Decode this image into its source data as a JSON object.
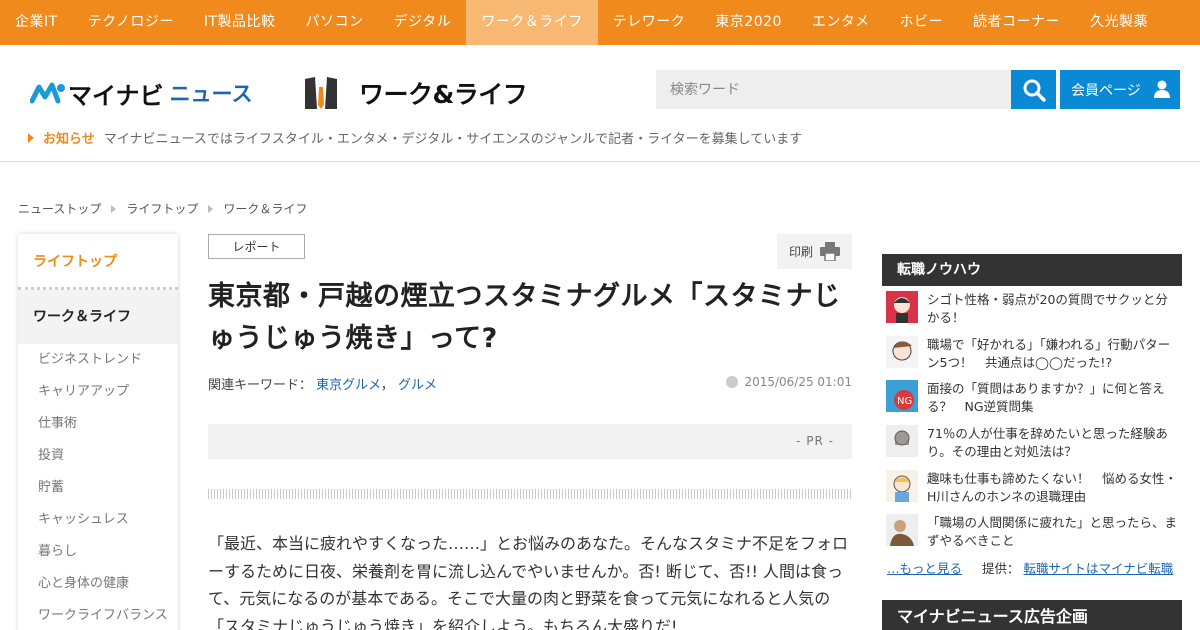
{
  "nav": {
    "items": [
      "企業IT",
      "テクノロジー",
      "IT製品比較",
      "パソコン",
      "デジタル",
      "ワーク＆ライフ",
      "テレワーク",
      "東京2020",
      "エンタメ",
      "ホビー",
      "読者コーナー",
      "久光製薬"
    ],
    "active_index": 5
  },
  "header": {
    "logo_text": "マイナビ",
    "logo_news": "ニュース",
    "section_title": "ワーク&ライフ",
    "search_placeholder": "検索ワード",
    "member_label": "会員ページ",
    "notice_label": "お知らせ",
    "notice_text": "マイナビニュースではライフスタイル・エンタメ・デジタル・サイエンスのジャンルで記者・ライターを募集しています"
  },
  "breadcrumb": [
    "ニューストップ",
    "ライフトップ",
    "ワーク＆ライフ"
  ],
  "leftnav": {
    "top": "ライフトップ",
    "current": "ワーク＆ライフ",
    "items": [
      "ビジネストレンド",
      "キャリアアップ",
      "仕事術",
      "投資",
      "貯蓄",
      "キャッシュレス",
      "暮らし",
      "心と身体の健康",
      "ワークライフバランス"
    ]
  },
  "article": {
    "tag": "レポート",
    "print_label": "印刷",
    "title": "東京都・戸越の煙立つスタミナグルメ「スタミナじゅうじゅう焼き」って?",
    "keywords_label": "関連キーワード：",
    "keywords": [
      "東京グルメ",
      "グルメ"
    ],
    "date": "2015/06/25 01:01",
    "pr_label": "- PR -",
    "body": "「最近、本当に疲れやすくなった……」とお悩みのあなた。そんなスタミナ不足をフォローするために日夜、栄養剤を胃に流し込んでやいませんか。否! 断じて、否!! 人間は食って、元気になるのが基本である。そこで大量の肉と野菜を食って元気になれると人気の「スタミナじゅうじゅう焼き」を紹介しよう。もちろん大盛りだ!"
  },
  "sidebar": {
    "job_title": "転職ノウハウ",
    "jobs": [
      "シゴト性格・弱点が20の質問でサクッと分かる！",
      "職場で「好かれる」「嫌われる」行動パターン5つ！　共通点は◯◯だった!?",
      "面接の「質問はありますか？」に何と答える？　NG逆質問集",
      "71％の人が仕事を辞めたいと思った経験あり。その理由と対処法は？",
      "趣味も仕事も諦めたくない！　悩める女性・H川さんのホンネの退職理由",
      "「職場の人間関係に疲れた」と思ったら、まずやるべきこと"
    ],
    "more_label": "…もっと見る",
    "provider_label": "提供：",
    "provider_link": "転職サイトはマイナビ転職",
    "ad_title": "マイナビニュース広告企画"
  },
  "colors": {
    "accent": "#f08a1c",
    "blue": "#0a8ad4",
    "link": "#1a66b3",
    "dark": "#333333"
  }
}
